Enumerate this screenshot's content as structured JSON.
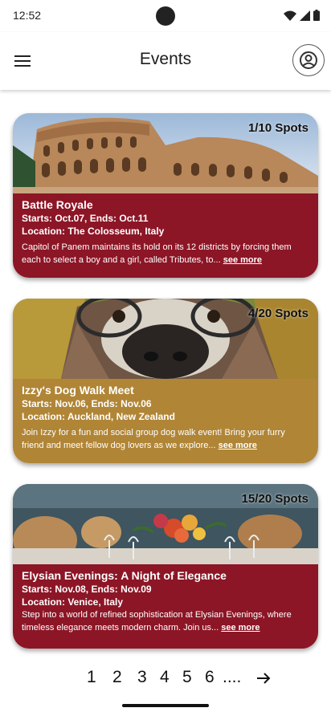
{
  "status_bar": {
    "time": "12:52"
  },
  "app_bar": {
    "title": "Events",
    "menu_icon": "hamburger-menu-icon",
    "profile_icon": "account-circle-icon"
  },
  "events": [
    {
      "spots": "1/10 Spots",
      "title": "Battle Royale",
      "dates": "Starts: Oct.07, Ends: Oct.11",
      "location": "Location: The Colosseum, Italy",
      "description": "Capitol of Panem maintains its hold on its 12 districts by forcing them each to select a boy and a girl, called Tributes, to...",
      "see_more": "see more",
      "color": "#8c1626"
    },
    {
      "spots": "4/20 Spots",
      "title": "Izzy's Dog Walk Meet",
      "dates": "Starts: Nov.06, Ends: Nov.06",
      "location": "Location: Auckland, New Zealand",
      "description": "Join Izzy for a fun and social group dog walk event! Bring your furry friend and meet fellow dog lovers as we explore...",
      "see_more": "see more",
      "color": "#b08536"
    },
    {
      "spots": "15/20 Spots",
      "title": "Elysian Evenings: A Night of Elegance",
      "dates": "Starts: Nov.08, Ends: Nov.09",
      "location": "Location: Venice, Italy",
      "description": "Step into a world of refined sophistication at Elysian Evenings, where timeless elegance meets modern charm. Join us...",
      "see_more": "see more",
      "color": "#8c1626"
    }
  ],
  "pagination": {
    "pages": [
      "1",
      "2",
      "3",
      "4",
      "5",
      "6"
    ],
    "ellipsis": "....",
    "next_icon": "arrow-right-icon"
  }
}
